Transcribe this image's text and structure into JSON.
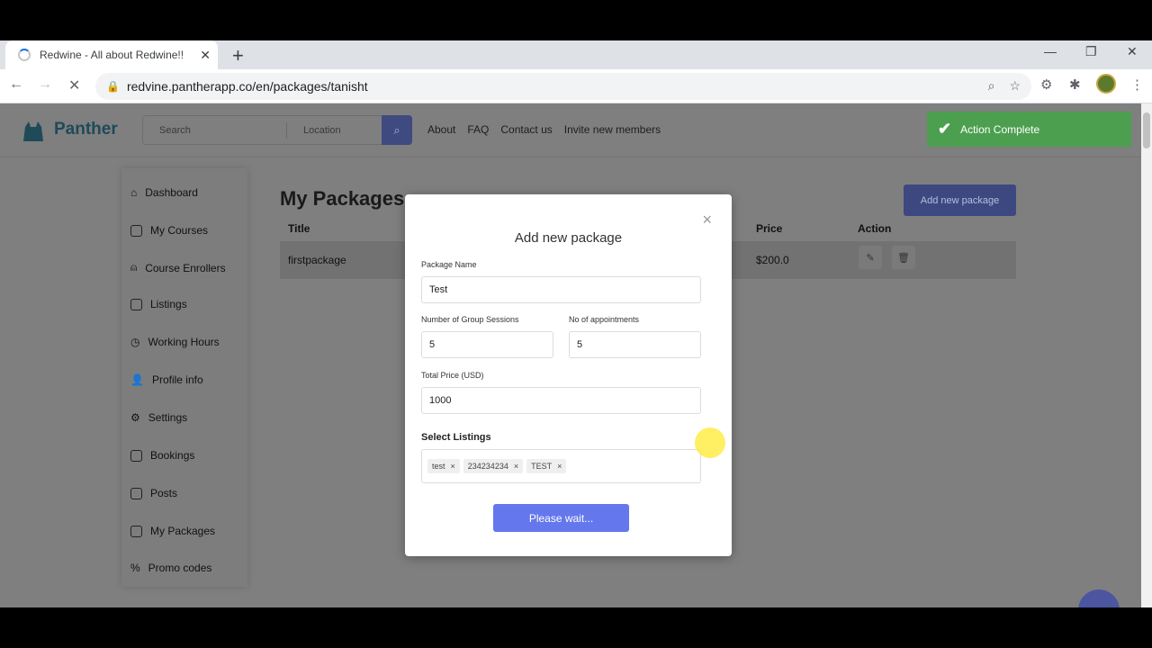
{
  "browser": {
    "tab_title": "Redwine - All about Redwine!!",
    "tab_close": "✕",
    "new_tab": "+",
    "url": "redvine.pantherapp.co/en/packages/tanisht",
    "win_min": "—",
    "win_restore": "❐",
    "win_close": "✕"
  },
  "header": {
    "logo_text": "Panther",
    "search_placeholder": "Search",
    "location_placeholder": "Location",
    "nav": [
      "About",
      "FAQ",
      "Contact us",
      "Invite new members"
    ]
  },
  "toast": {
    "text": "Action Complete",
    "color": "#4c9f4f"
  },
  "sidebar": {
    "items": [
      "Dashboard",
      "My Courses",
      "Course Enrollers",
      "Listings",
      "Working Hours",
      "Profile info",
      "Settings",
      "Bookings",
      "Posts",
      "My Packages",
      "Promo codes"
    ]
  },
  "main": {
    "title": "My Packages",
    "add_button": "Add new package",
    "columns": {
      "title": "Title",
      "price": "Price",
      "action": "Action"
    },
    "rows": [
      {
        "title": "firstpackage",
        "price": "$200.0"
      }
    ]
  },
  "modal": {
    "title": "Add new package",
    "close": "×",
    "package_name_label": "Package Name",
    "package_name_value": "Test",
    "group_sessions_label": "Number of Group Sessions",
    "group_sessions_value": "5",
    "appointments_label": "No of appointments",
    "appointments_value": "5",
    "price_label": "Total Price (USD)",
    "price_value": "1000",
    "listings_label": "Select Listings",
    "tags": [
      "test",
      "234234234",
      "TEST"
    ],
    "tag_remove": "×",
    "submit_label": "Please wait...",
    "accent": "#6477ec"
  }
}
